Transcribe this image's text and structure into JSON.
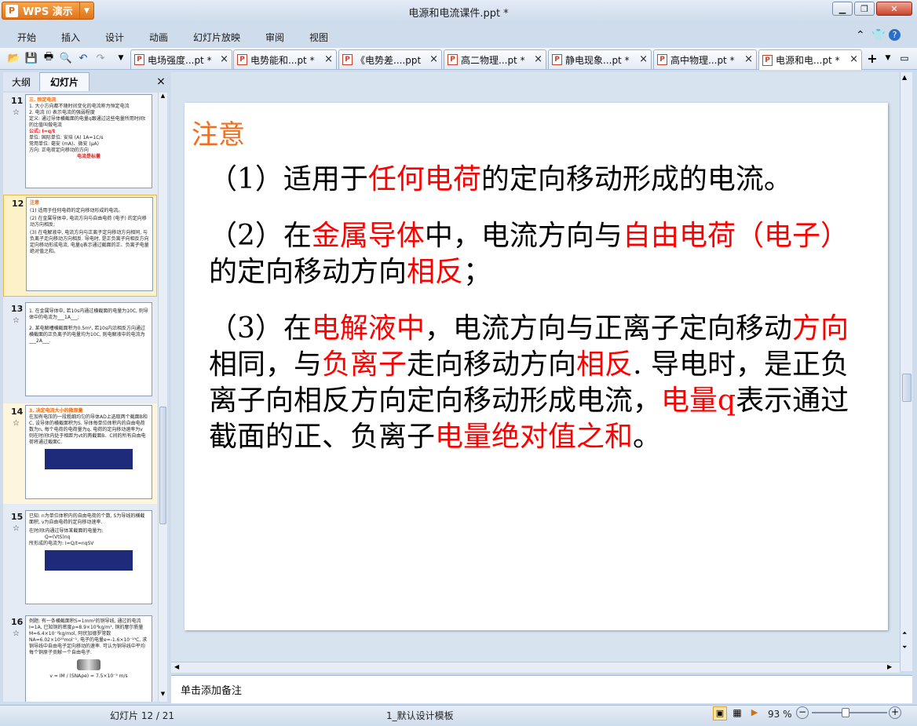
{
  "app": {
    "name": "WPS 演示",
    "document_title": "电源和电流课件.ppt *"
  },
  "menu": [
    "开始",
    "插入",
    "设计",
    "动画",
    "幻灯片放映",
    "审阅",
    "视图"
  ],
  "tabs": [
    {
      "label": "电场强度...pt *"
    },
    {
      "label": "电势能和...pt *"
    },
    {
      "label": "《电势差....ppt"
    },
    {
      "label": "高二物理...pt *"
    },
    {
      "label": "静电现象...pt *"
    },
    {
      "label": "高中物理...pt *"
    },
    {
      "label": "电源和电...pt *",
      "active": true
    }
  ],
  "panel": {
    "tab_outline": "大纲",
    "tab_slides": "幻灯片"
  },
  "thumbnails": [
    {
      "num": "11",
      "lines": [
        "三. 恒定电流",
        "1. 大小方向都不随时间变化的电流称为恒定电流",
        "2. 电流 (I) 表示电流的强弱程度",
        "定义: 通过导体横截面的电量q跟通过这些电量所用时间t的比值叫做电流",
        "公式: I=q/t",
        "单位: 国际单位: 安培 (A)  1A=1C/s",
        "常用单位: 毫安 (mA)、微安 (μA)",
        "方向: 正电荷定向移动的方向",
        "电流是标量"
      ]
    },
    {
      "num": "12",
      "lines": [
        "注意",
        "(1) 适用于任何电荷的定向移动形成的电流。",
        "(2) 在金属导体中, 电流方向与自由电荷 (电子) 的定向移动方向相反;",
        "(3) 在电解液中, 电流方向与正离子定向移动方向相同, 与负离子走向移动方向相反. 导电时, 是正负离子向相反方向定向移动形成电流, 电量q表示通过截面的正、负离子电量绝对值之和。"
      ]
    },
    {
      "num": "13",
      "lines": [
        "1. 在金属导体中, 若10s内通过横截面的电量为10C, 则导体中的电流为___1A___;",
        "2. 某电解槽横截面积为0.5m², 若10s内沿相反方向通过横截面的正负离子的电量均为10C, 则电解液中的电流为___2A___."
      ]
    },
    {
      "num": "14",
      "lines": [
        "3. 决定电流大小的微观量",
        "在加有电压的一段粗细均匀的导体AD上选取两个截面B和C, 设导体的横截面积为S. 导体每单位体积内的自由电荷数为n, 每个电荷的电荷量为q, 电荷的定向移动速率为v",
        "则在时间t内处于相距为vt的两截面B、C间的所有自由电荷将通过截面C."
      ]
    },
    {
      "num": "15",
      "lines": [
        "已知: n为单位体积内的自由电荷的个数, S为导线的横截面积, v为自由电荷的定向移动速率.",
        "在时间t内通过导体某截面的电量为:",
        "Q=(VtS)nq",
        "所形成的电流为: I=Q/t=nqSV"
      ]
    },
    {
      "num": "16",
      "lines": [
        "例题: 有一条横截面积S=1mm²的铜导线, 通过的电流I=1A, 已知铜的密度ρ=8.9×10³kg/m³, 铜的摩尔质量M=6.4×10⁻²kg/mol, 阿伏加德罗常数NA=6.02×10²³mol⁻¹, 电子的电量e=-1.6×10⁻¹⁹C, 求铜导线中自由电子定向移动的速率. 可认为铜导线中平均每个铜原子贡献一个自由电子.",
        "v = IM / (SNAρe) = 7.5×10⁻⁵ m/s"
      ]
    }
  ],
  "slide": {
    "title": "注意",
    "p1": {
      "t1": "（1）适用于",
      "r1": "任何电荷",
      "t2": "的定向移动形成的电流。"
    },
    "p2": {
      "t1": "（2）在",
      "r1": "金属导体",
      "t2": "中，电流方向与",
      "r2": "自由电荷（电子）",
      "t3": "的定向移动方向",
      "r3": "相反",
      "t4": "；"
    },
    "p3": {
      "t1": "（3）在",
      "r1": "电解液中",
      "t2": "，电流方向与正离子定向移动",
      "r2": "方向",
      "t3": "相同，与",
      "r3": "负离子",
      "t4": "走向移动方向",
      "r4": "相反",
      "t5": ". 导电时，是正负离子向相反方向定向移动形成电流，",
      "r5": "电量q",
      "t6": "表示通过截面的正、负离子",
      "r6": "电量绝对值之和",
      "t7": "。"
    }
  },
  "notes_placeholder": "单击添加备注",
  "status": {
    "slide_counter": "幻灯片 12 / 21",
    "template": "1_默认设计模板",
    "zoom": "93 %"
  },
  "colors": {
    "accent_orange": "#f06e1e",
    "emphasis_red": "#ff0000",
    "chrome_blue": "#cfdcec"
  }
}
